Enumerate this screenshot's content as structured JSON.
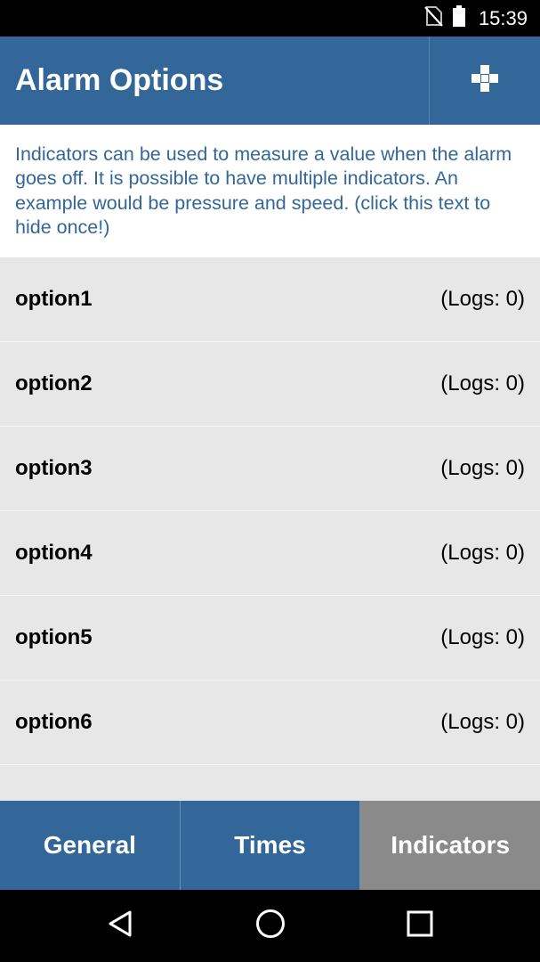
{
  "status_bar": {
    "time": "15:39",
    "icons": [
      "no-sim-icon",
      "battery-icon"
    ]
  },
  "app_bar": {
    "title": "Alarm Options",
    "add_button_icon": "plus-icon"
  },
  "info_banner": {
    "text": "Indicators can be used to measure a value when the alarm goes off. It is possible to have multiple indicators. An example would be pressure and speed. (click this text to hide once!)"
  },
  "options": [
    {
      "name": "option1",
      "logs": "(Logs: 0)"
    },
    {
      "name": "option2",
      "logs": "(Logs: 0)"
    },
    {
      "name": "option3",
      "logs": "(Logs: 0)"
    },
    {
      "name": "option4",
      "logs": "(Logs: 0)"
    },
    {
      "name": "option5",
      "logs": "(Logs: 0)"
    },
    {
      "name": "option6",
      "logs": "(Logs: 0)"
    }
  ],
  "tabs": [
    {
      "label": "General",
      "active": false
    },
    {
      "label": "Times",
      "active": false
    },
    {
      "label": "Indicators",
      "active": true
    }
  ],
  "nav_bar": {
    "icons": [
      "back-icon",
      "home-icon",
      "recents-icon"
    ]
  },
  "colors": {
    "primary": "#336699",
    "tab_active": "#8a8a8a",
    "list_background": "#e7e7e7"
  }
}
